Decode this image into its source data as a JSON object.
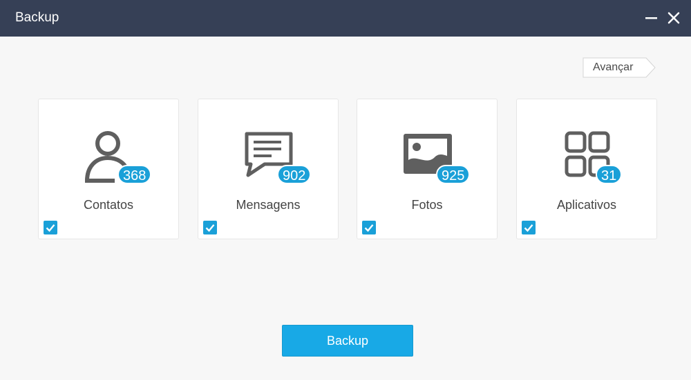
{
  "window": {
    "title": "Backup"
  },
  "toolbar": {
    "advance_label": "Avançar"
  },
  "cards": [
    {
      "label": "Contatos",
      "count": "368",
      "icon": "contacts-icon",
      "checked": true
    },
    {
      "label": "Mensagens",
      "count": "902",
      "icon": "messages-icon",
      "checked": true
    },
    {
      "label": "Fotos",
      "count": "925",
      "icon": "photos-icon",
      "checked": true
    },
    {
      "label": "Aplicativos",
      "count": "31",
      "icon": "apps-icon",
      "checked": true
    }
  ],
  "actions": {
    "backup_label": "Backup"
  },
  "colors": {
    "titlebar": "#364056",
    "accent": "#1aa0d8",
    "button": "#18a9e6",
    "icon": "#5f5f5f"
  }
}
